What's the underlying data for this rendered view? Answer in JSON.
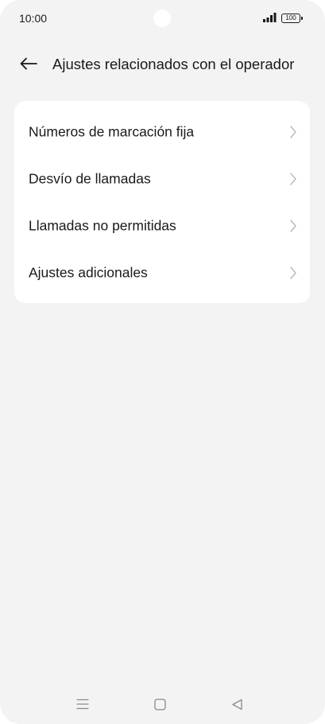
{
  "status_bar": {
    "time": "10:00",
    "battery": "100",
    "icons": [
      "signal-icon",
      "battery-icon"
    ]
  },
  "header": {
    "back_icon": "arrow-left-icon",
    "title": "Ajustes relacionados con el operador"
  },
  "menu": {
    "items": [
      {
        "label": "Números de marcación fija",
        "icon": "chevron-right-icon"
      },
      {
        "label": "Desvío de llamadas",
        "icon": "chevron-right-icon"
      },
      {
        "label": "Llamadas no permitidas",
        "icon": "chevron-right-icon"
      },
      {
        "label": "Ajustes adicionales",
        "icon": "chevron-right-icon"
      }
    ]
  },
  "nav_bar": {
    "icons": [
      "menu-icon",
      "home-icon",
      "back-triangle-icon"
    ]
  },
  "colors": {
    "background": "#f3f3f3",
    "card": "#ffffff",
    "text": "#1a1a1a",
    "chevron": "#b8b8b8",
    "nav_icon": "#8a8a8a"
  }
}
